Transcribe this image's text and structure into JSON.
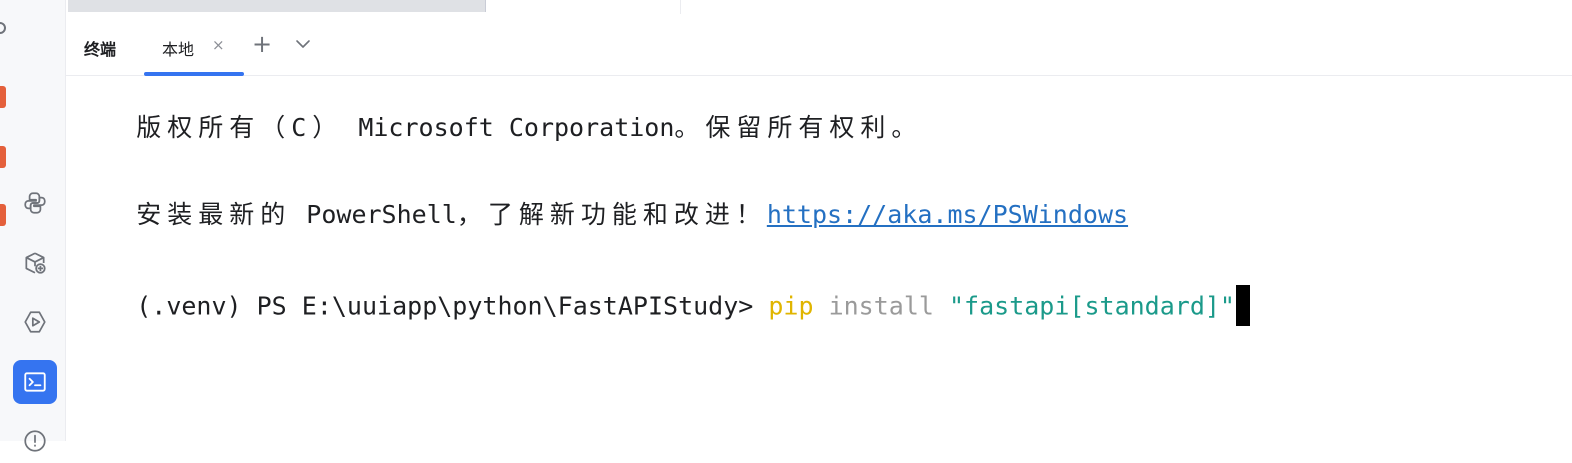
{
  "sidebar": {
    "tools": [
      {
        "icon": "python-icon"
      },
      {
        "icon": "python-packages-icon"
      },
      {
        "icon": "services-icon"
      },
      {
        "icon": "terminal-icon",
        "active": true
      },
      {
        "icon": "problems-icon"
      }
    ]
  },
  "panel": {
    "title": "终端",
    "tabs": [
      {
        "label": "本地",
        "close": "×"
      }
    ],
    "add_label": "+"
  },
  "terminal": {
    "copyright_line": "版权所有（C） Microsoft Corporation。保留所有权利。",
    "copyright_cjk_1": "版权所有（C）",
    "copyright_latin": " Microsoft Corporation",
    "copyright_cjk_2": "。保留所有权利。",
    "notice_cjk": "安装最新的",
    "notice_latin": " PowerShell",
    "notice_cjk_2": "，了解新功能和改进！",
    "notice_link": "https://aka.ms/PSWindows",
    "prompt": "(.venv) PS E:\\uuiapp\\python\\FastAPIStudy> ",
    "command": {
      "program": "pip",
      "arg": " install ",
      "string": "\"fastapi[standard]\""
    }
  },
  "colors": {
    "accent": "#3574f0",
    "link": "#2470c2",
    "cmd_program": "#e0b500",
    "cmd_arg": "#9a9a9a",
    "cmd_string": "#1b9a8a"
  }
}
